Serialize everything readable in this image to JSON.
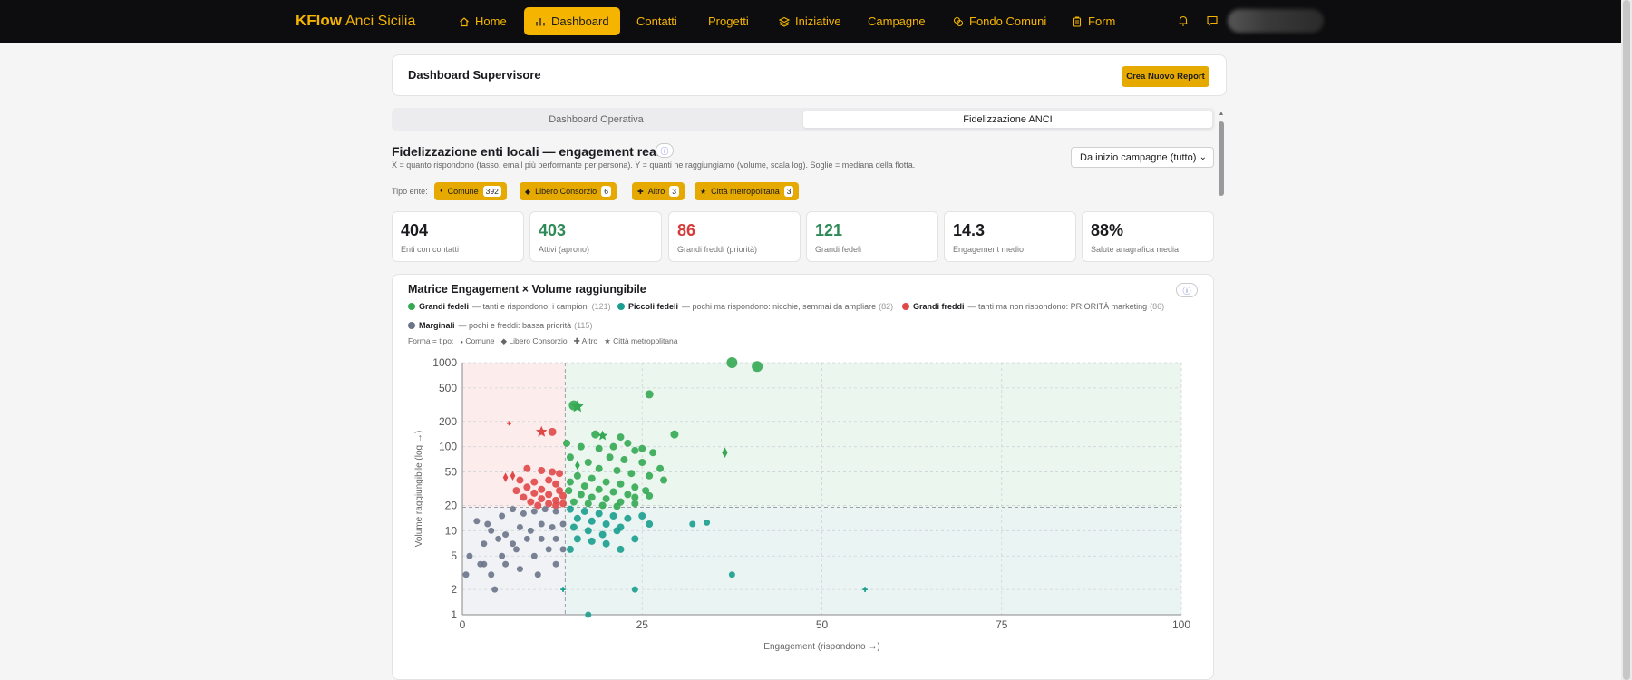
{
  "brand": {
    "name": "KFlow",
    "sub": "Anci Sicilia"
  },
  "nav": [
    {
      "label": "Home",
      "icon": "home-icon"
    },
    {
      "label": "Dashboard",
      "icon": "bar-chart-icon",
      "active": true
    },
    {
      "label": "Contatti"
    },
    {
      "label": "Progetti"
    },
    {
      "label": "Iniziative",
      "icon": "layers-icon"
    },
    {
      "label": "Campagne"
    },
    {
      "label": "Fondo Comuni",
      "icon": "coins-icon"
    },
    {
      "label": "Form",
      "icon": "clipboard-icon"
    }
  ],
  "header": {
    "title": "Dashboard Supervisore",
    "report_button": "Crea Nuovo Report"
  },
  "tabs": [
    {
      "label": "Dashboard Operativa"
    },
    {
      "label": "Fidelizzazione ANCI",
      "active": true
    }
  ],
  "section": {
    "title": "Fidelizzazione enti locali — engagement reale",
    "description": "X = quanto rispondono (tasso, email più performante per persona). Y = quanti ne raggiungiamo (volume, scala log). Soglie = mediana della flotta.",
    "period_select": "Da inizio campagne (tutto)"
  },
  "filters": {
    "label": "Tipo ente:",
    "chips": [
      {
        "label": "Comune",
        "count": "392",
        "symbol": "●"
      },
      {
        "label": "Libero Consorzio",
        "count": "6",
        "symbol": "◆"
      },
      {
        "label": "Altro",
        "count": "3",
        "symbol": "✚"
      },
      {
        "label": "Città metropolitana",
        "count": "3",
        "symbol": "★"
      }
    ]
  },
  "kpis": [
    {
      "value": "404",
      "label": "Enti con contatti",
      "color": "#1b1b1f"
    },
    {
      "value": "403",
      "label": "Attivi (aprono)",
      "color": "#2e8b57"
    },
    {
      "value": "86",
      "label": "Grandi freddi (priorità)",
      "color": "#d73a3a"
    },
    {
      "value": "121",
      "label": "Grandi fedeli",
      "color": "#2e8b57"
    },
    {
      "value": "14.3",
      "label": "Engagement medio",
      "color": "#1b1b1f"
    },
    {
      "value": "88%",
      "label": "Salute anagrafica media",
      "color": "#1b1b1f"
    }
  ],
  "chart": {
    "title": "Matrice Engagement × Volume raggiungibile",
    "legend": [
      {
        "name": "Grandi fedeli",
        "desc": "— tanti e rispondono: i campioni",
        "count": "(121)",
        "color": "#34a853"
      },
      {
        "name": "Piccoli fedeli",
        "desc": "— pochi ma rispondono: nicchie, semmai da ampliare",
        "count": "(82)",
        "color": "#1a9e8f"
      },
      {
        "name": "Grandi freddi",
        "desc": "— tanti ma non rispondono: PRIORITÀ marketing",
        "count": "(86)",
        "color": "#e04848"
      },
      {
        "name": "Marginali",
        "desc": "— pochi e freddi: bassa priorità",
        "count": "(115)",
        "color": "#6b7489"
      }
    ],
    "shape_label": "Forma = tipo:",
    "shapes": [
      {
        "symbol": "●",
        "label": "Comune"
      },
      {
        "symbol": "◆",
        "label": "Libero Consorzio"
      },
      {
        "symbol": "✚",
        "label": "Altro"
      },
      {
        "symbol": "★",
        "label": "Città metropolitana"
      }
    ]
  },
  "chart_data": {
    "type": "scatter",
    "xlabel": "Engagement (rispondono →)",
    "ylabel": "Volume raggiungibile (log →)",
    "xlim": [
      0,
      100
    ],
    "ylim": [
      1,
      1000
    ],
    "yscale": "log",
    "x_ticks": [
      0,
      25,
      50,
      75,
      100
    ],
    "y_ticks": [
      1,
      2,
      5,
      10,
      20,
      50,
      100,
      200,
      500,
      1000
    ],
    "thresholds": {
      "x": 14.3,
      "y": 19
    },
    "grid": true,
    "series": [
      {
        "name": "Grandi fedeli",
        "color": "#34a853",
        "points": [
          [
            37.5,
            1000,
            12,
            "circle"
          ],
          [
            41,
            900,
            12,
            "circle"
          ],
          [
            26,
            420,
            9,
            "circle"
          ],
          [
            15.5,
            310,
            11,
            "circle"
          ],
          [
            16,
            300,
            12,
            "star"
          ],
          [
            29.5,
            140,
            9,
            "circle"
          ],
          [
            18.5,
            140,
            9,
            "circle"
          ],
          [
            19.5,
            135,
            10,
            "star"
          ],
          [
            22,
            130,
            8,
            "circle"
          ],
          [
            36.5,
            85,
            9,
            "diamond"
          ],
          [
            14.5,
            110,
            8,
            "circle"
          ],
          [
            16.5,
            100,
            8,
            "circle"
          ],
          [
            19,
            95,
            8,
            "circle"
          ],
          [
            21,
            100,
            8,
            "circle"
          ],
          [
            23,
            110,
            8,
            "circle"
          ],
          [
            24,
            90,
            8,
            "circle"
          ],
          [
            26.5,
            85,
            8,
            "circle"
          ],
          [
            20.5,
            75,
            8,
            "circle"
          ],
          [
            22.5,
            70,
            8,
            "circle"
          ],
          [
            25,
            65,
            8,
            "circle"
          ],
          [
            27.5,
            55,
            8,
            "circle"
          ],
          [
            15,
            75,
            8,
            "circle"
          ],
          [
            17.5,
            65,
            8,
            "circle"
          ],
          [
            19,
            55,
            8,
            "circle"
          ],
          [
            21.5,
            52,
            8,
            "circle"
          ],
          [
            23.5,
            48,
            8,
            "circle"
          ],
          [
            26,
            45,
            8,
            "circle"
          ],
          [
            28,
            40,
            8,
            "circle"
          ],
          [
            16,
            45,
            8,
            "circle"
          ],
          [
            18,
            42,
            8,
            "circle"
          ],
          [
            20,
            38,
            8,
            "circle"
          ],
          [
            22,
            36,
            8,
            "circle"
          ],
          [
            24,
            33,
            8,
            "circle"
          ],
          [
            25.5,
            30,
            8,
            "circle"
          ],
          [
            15,
            38,
            8,
            "circle"
          ],
          [
            17,
            34,
            8,
            "circle"
          ],
          [
            19,
            31,
            8,
            "circle"
          ],
          [
            21,
            29,
            8,
            "circle"
          ],
          [
            23,
            27,
            8,
            "circle"
          ],
          [
            14.8,
            30,
            8,
            "circle"
          ],
          [
            16.5,
            27,
            8,
            "circle"
          ],
          [
            18,
            25,
            8,
            "circle"
          ],
          [
            20,
            24,
            8,
            "circle"
          ],
          [
            22,
            22,
            8,
            "circle"
          ],
          [
            24,
            21,
            8,
            "circle"
          ],
          [
            15.5,
            22,
            8,
            "circle"
          ],
          [
            17.5,
            21,
            8,
            "circle"
          ],
          [
            19.5,
            20,
            8,
            "circle"
          ],
          [
            21.5,
            19.5,
            8,
            "circle"
          ],
          [
            16,
            60,
            8,
            "diamond"
          ],
          [
            25,
            95,
            8,
            "circle"
          ],
          [
            24,
            25,
            8,
            "circle"
          ],
          [
            26,
            26,
            8,
            "circle"
          ]
        ]
      },
      {
        "name": "Piccoli fedeli",
        "color": "#1a9e8f",
        "points": [
          [
            15,
            18,
            8,
            "circle"
          ],
          [
            17,
            17,
            8,
            "circle"
          ],
          [
            19,
            16,
            8,
            "circle"
          ],
          [
            21,
            15,
            8,
            "circle"
          ],
          [
            23,
            14,
            8,
            "circle"
          ],
          [
            25,
            15,
            8,
            "circle"
          ],
          [
            16,
            14,
            8,
            "circle"
          ],
          [
            18,
            13,
            8,
            "circle"
          ],
          [
            20,
            12,
            8,
            "circle"
          ],
          [
            22,
            11,
            8,
            "circle"
          ],
          [
            15.5,
            11,
            8,
            "circle"
          ],
          [
            17.5,
            10,
            8,
            "circle"
          ],
          [
            19.5,
            9,
            8,
            "circle"
          ],
          [
            21.5,
            10,
            8,
            "circle"
          ],
          [
            16,
            8,
            8,
            "circle"
          ],
          [
            18,
            7.5,
            8,
            "circle"
          ],
          [
            20,
            7,
            8,
            "circle"
          ],
          [
            24,
            8,
            8,
            "circle"
          ],
          [
            26,
            12,
            8,
            "circle"
          ],
          [
            32,
            12,
            7,
            "circle"
          ],
          [
            34,
            12.5,
            7,
            "circle"
          ],
          [
            37.5,
            3,
            7,
            "circle"
          ],
          [
            24,
            2,
            7,
            "circle"
          ],
          [
            17.5,
            1,
            7,
            "circle"
          ],
          [
            14,
            2,
            8,
            "plus"
          ],
          [
            56,
            2,
            8,
            "plus"
          ],
          [
            15,
            6,
            8,
            "circle"
          ],
          [
            22,
            6,
            8,
            "circle"
          ]
        ]
      },
      {
        "name": "Grandi freddi",
        "color": "#e04848",
        "points": [
          [
            6.5,
            190,
            7,
            "plus"
          ],
          [
            11,
            150,
            11,
            "star"
          ],
          [
            12.5,
            150,
            9,
            "circle"
          ],
          [
            7,
            45,
            8,
            "diamond"
          ],
          [
            6,
            43,
            8,
            "diamond"
          ],
          [
            9,
            55,
            8,
            "circle"
          ],
          [
            11,
            52,
            8,
            "circle"
          ],
          [
            12.5,
            50,
            8,
            "circle"
          ],
          [
            13.5,
            48,
            8,
            "circle"
          ],
          [
            8,
            40,
            8,
            "circle"
          ],
          [
            10,
            38,
            8,
            "circle"
          ],
          [
            12,
            40,
            8,
            "circle"
          ],
          [
            13,
            36,
            8,
            "circle"
          ],
          [
            9,
            33,
            8,
            "circle"
          ],
          [
            11,
            31,
            8,
            "circle"
          ],
          [
            13.5,
            30,
            8,
            "circle"
          ],
          [
            7.5,
            30,
            8,
            "circle"
          ],
          [
            10,
            28,
            8,
            "circle"
          ],
          [
            12,
            27,
            8,
            "circle"
          ],
          [
            14,
            26,
            8,
            "circle"
          ],
          [
            8.5,
            25,
            8,
            "circle"
          ],
          [
            11,
            24,
            8,
            "circle"
          ],
          [
            13,
            23,
            8,
            "circle"
          ],
          [
            9.5,
            22,
            8,
            "circle"
          ],
          [
            12,
            21,
            8,
            "circle"
          ],
          [
            14,
            21,
            8,
            "circle"
          ],
          [
            10.5,
            20,
            8,
            "circle"
          ],
          [
            13,
            20,
            8,
            "circle"
          ]
        ]
      },
      {
        "name": "Marginali",
        "color": "#6b7489",
        "points": [
          [
            2,
            13,
            7,
            "circle"
          ],
          [
            3.5,
            12,
            7,
            "circle"
          ],
          [
            5.5,
            15,
            7,
            "circle"
          ],
          [
            7,
            18,
            7,
            "circle"
          ],
          [
            8.5,
            16,
            7,
            "circle"
          ],
          [
            10,
            17,
            7,
            "circle"
          ],
          [
            11.5,
            18,
            7,
            "circle"
          ],
          [
            13,
            17,
            7,
            "circle"
          ],
          [
            4,
            10,
            7,
            "circle"
          ],
          [
            6,
            9,
            7,
            "circle"
          ],
          [
            8,
            11,
            7,
            "circle"
          ],
          [
            9.5,
            10,
            7,
            "circle"
          ],
          [
            11,
            12,
            7,
            "circle"
          ],
          [
            12.5,
            11,
            7,
            "circle"
          ],
          [
            14,
            12,
            7,
            "circle"
          ],
          [
            3,
            7,
            7,
            "circle"
          ],
          [
            5,
            8,
            7,
            "circle"
          ],
          [
            7,
            7,
            7,
            "circle"
          ],
          [
            9,
            8,
            7,
            "circle"
          ],
          [
            11,
            8,
            7,
            "circle"
          ],
          [
            13,
            8,
            7,
            "circle"
          ],
          [
            1,
            5,
            7,
            "circle"
          ],
          [
            3,
            4,
            7,
            "circle"
          ],
          [
            5.5,
            5,
            7,
            "circle"
          ],
          [
            7.5,
            6,
            7,
            "circle"
          ],
          [
            10,
            5,
            7,
            "circle"
          ],
          [
            12,
            6,
            7,
            "circle"
          ],
          [
            2.5,
            4,
            7,
            "circle"
          ],
          [
            4,
            3,
            7,
            "circle"
          ],
          [
            6,
            4,
            7,
            "circle"
          ],
          [
            8,
            3.5,
            7,
            "circle"
          ],
          [
            10.5,
            3,
            7,
            "circle"
          ],
          [
            0.5,
            3,
            7,
            "circle"
          ],
          [
            4.5,
            2,
            7,
            "circle"
          ],
          [
            13,
            4,
            7,
            "circle"
          ],
          [
            14,
            6,
            7,
            "circle"
          ]
        ]
      }
    ]
  }
}
